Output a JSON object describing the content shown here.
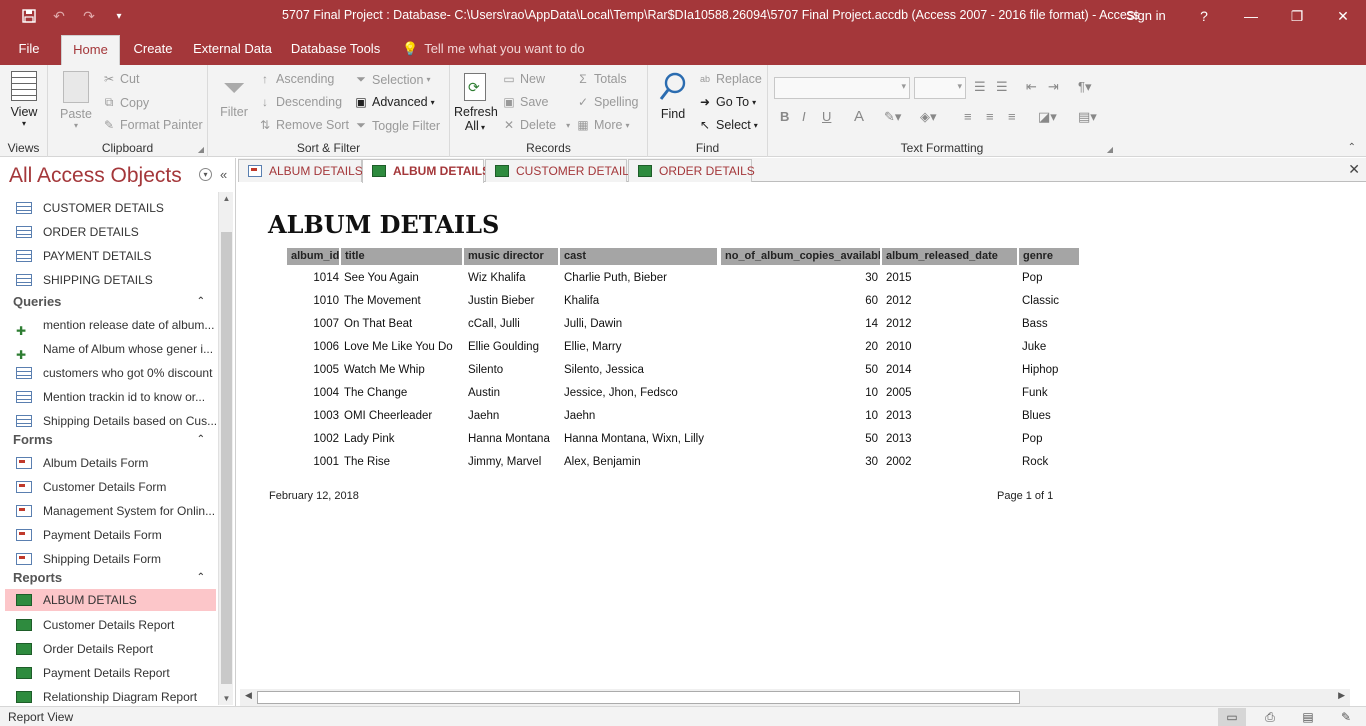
{
  "titlebar": {
    "title": "5707 Final Project : Database- C:\\Users\\rao\\AppData\\Local\\Temp\\Rar$DIa10588.26094\\5707 Final Project.accdb (Access 2007 - 2016 file format)  -  Access",
    "signin": "Sign in",
    "help": "?",
    "minimize": "—",
    "restore": "❐",
    "close": "✕"
  },
  "ribbon_tabs": {
    "file": "File",
    "home": "Home",
    "create": "Create",
    "external": "External Data",
    "dbtools": "Database Tools",
    "tell": "Tell me what you want to do"
  },
  "ribbon": {
    "views": {
      "view": "View",
      "label": "Views"
    },
    "clipboard": {
      "paste": "Paste",
      "cut": "Cut",
      "copy": "Copy",
      "format_painter": "Format Painter",
      "label": "Clipboard"
    },
    "sort_filter": {
      "filter": "Filter",
      "ascending": "Ascending",
      "descending": "Descending",
      "remove_sort": "Remove Sort",
      "selection": "Selection",
      "advanced": "Advanced",
      "toggle_filter": "Toggle Filter",
      "label": "Sort & Filter"
    },
    "records": {
      "refresh": "Refresh",
      "refresh_all": "All",
      "new": "New",
      "save": "Save",
      "delete": "Delete",
      "totals": "Totals",
      "spelling": "Spelling",
      "more": "More",
      "label": "Records"
    },
    "find": {
      "find": "Find",
      "replace": "Replace",
      "goto": "Go To",
      "select": "Select",
      "label": "Find"
    },
    "text_formatting": {
      "label": "Text Formatting",
      "bold": "B",
      "italic": "I",
      "underline": "U",
      "font_color": "A"
    }
  },
  "navpane": {
    "header": "All Access Objects",
    "tables": [
      "CUSTOMER DETAILS",
      "ORDER DETAILS",
      "PAYMENT DETAILS",
      "SHIPPING DETAILS"
    ],
    "queries_label": "Queries",
    "queries": [
      "mention release date of album...",
      "Name of Album whose gener i...",
      "customers who got 0% discount",
      "Mention trackin id to know or...",
      "Shipping Details based on Cus..."
    ],
    "forms_label": "Forms",
    "forms": [
      "Album Details Form",
      "Customer Details Form",
      "Management System for Onlin...",
      "Payment Details Form",
      "Shipping Details Form"
    ],
    "reports_label": "Reports",
    "reports": [
      "ALBUM DETAILS",
      "Customer Details Report",
      "Order Details Report",
      "Payment Details Report",
      "Relationship Diagram Report"
    ]
  },
  "doc_tabs": [
    "ALBUM DETAILS",
    "ALBUM DETAILS",
    "CUSTOMER DETAILS",
    "ORDER DETAILS"
  ],
  "report": {
    "title": "ALBUM DETAILS",
    "columns": [
      "album_id",
      "title",
      "music director",
      "cast",
      "no_of_album_copies_available",
      "album_released_date",
      "genre"
    ],
    "rows": [
      [
        "1014",
        "See You Again",
        "Wiz Khalifa",
        "Charlie Puth, Bieber",
        "30",
        "2015",
        "Pop"
      ],
      [
        "1010",
        "The Movement",
        "Justin Bieber",
        " Khalifa",
        "60",
        "2012",
        "Classic"
      ],
      [
        "1007",
        "On That Beat",
        "cCall, Julli",
        "Julli, Dawin",
        "14",
        "2012",
        "Bass"
      ],
      [
        "1006",
        "Love Me Like You Do",
        "Ellie Goulding",
        "Ellie, Marry",
        "20",
        "2010",
        "Juke"
      ],
      [
        "1005",
        "Watch Me Whip",
        "Silento",
        "Silento, Jessica",
        "50",
        "2014",
        "Hiphop"
      ],
      [
        "1004",
        "The Change",
        "Austin",
        "Jessice, Jhon, Fedsco",
        "10",
        "2005",
        "Funk"
      ],
      [
        "1003",
        "OMI Cheerleader",
        "Jaehn",
        "Jaehn",
        "10",
        "2013",
        "Blues"
      ],
      [
        "1002",
        "Lady Pink",
        "Hanna Montana",
        "Hanna Montana, Wixn, Lilly",
        "50",
        "2013",
        "Pop"
      ],
      [
        "1001",
        "The Rise",
        "Jimmy, Marvel",
        "Alex, Benjamin",
        "30",
        "2002",
        "Rock"
      ]
    ],
    "date": "February 12, 2018",
    "page": "Page 1 of 1"
  },
  "status": {
    "text": "Report View"
  },
  "colors": {
    "accent": "#a4373a",
    "selected_nav": "#fcc6c9",
    "header_cell": "#a5a5a5"
  }
}
